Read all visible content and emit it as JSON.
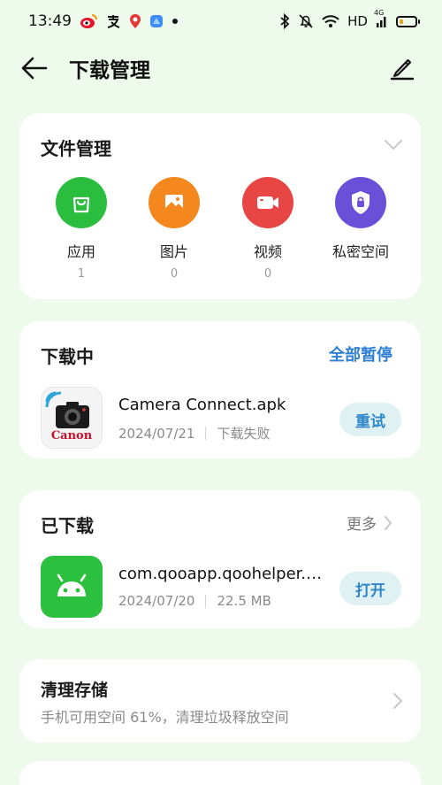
{
  "status_bar": {
    "time": "13:49",
    "network_label": "HD",
    "signal_label": "4G",
    "left_icons": [
      "weibo-icon",
      "alipay-icon",
      "maps-pin-icon",
      "app-icon",
      "dot-icon"
    ],
    "right_icons": [
      "bluetooth-icon",
      "mute-bell-icon",
      "wifi-icon",
      "signal-icon",
      "battery-icon"
    ]
  },
  "header": {
    "title": "下载管理",
    "back_icon": "back-arrow-icon",
    "edit_icon": "edit-pencil-icon"
  },
  "file_management": {
    "title": "文件管理",
    "categories": [
      {
        "label": "应用",
        "count": "1",
        "icon": "shopping-bag-icon",
        "color": "#2bbd3e"
      },
      {
        "label": "图片",
        "count": "0",
        "icon": "image-icon",
        "color": "#f5871f"
      },
      {
        "label": "视频",
        "count": "0",
        "icon": "video-icon",
        "color": "#e84545"
      },
      {
        "label": "私密空间",
        "count": "",
        "icon": "lock-shield-icon",
        "color": "#6a4fd8"
      }
    ]
  },
  "downloading": {
    "title": "下载中",
    "action": "全部暂停",
    "items": [
      {
        "name": "Camera Connect.apk",
        "date": "2024/07/21",
        "status": "下载失败",
        "button": "重试",
        "thumb_text": "Canon"
      }
    ]
  },
  "downloaded": {
    "title": "已下载",
    "more": "更多",
    "items": [
      {
        "name": "com.qooapp.qoohelper.a...",
        "date": "2024/07/20",
        "size": "22.5 MB",
        "button": "打开"
      }
    ]
  },
  "clean_storage": {
    "title": "清理存储",
    "subtitle": "手机可用空间 61%，清理垃圾释放空间"
  },
  "colors": {
    "background": "#eefaec",
    "accent_blue": "#2e7fd6",
    "pill_bg": "#dff1f3",
    "android_green": "#2bc03e"
  }
}
